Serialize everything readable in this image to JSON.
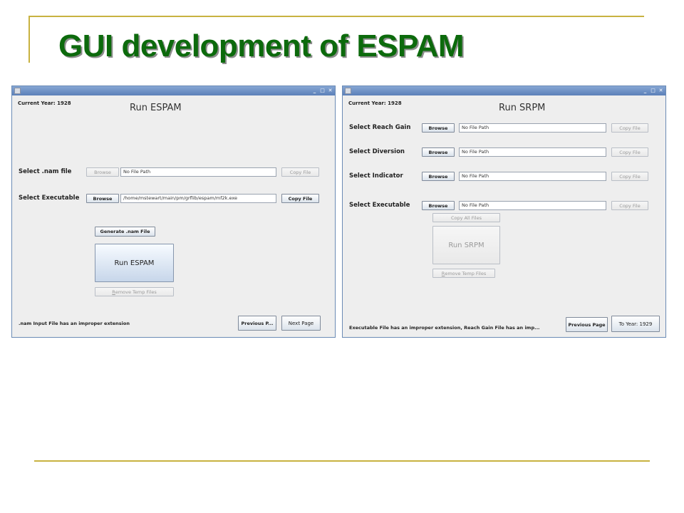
{
  "slide": {
    "title": "GUI development of ESPAM"
  },
  "window_controls": {
    "minimize": "_",
    "maximize": "□",
    "close": "✕"
  },
  "espam": {
    "current_year": "Current Year: 1928",
    "heading": "Run ESPAM",
    "nam_label": "Select .nam file",
    "nam_browse": "Browse",
    "nam_path": "No File Path",
    "nam_copy": "Copy File",
    "exe_label": "Select Executable",
    "exe_browse": "Browse",
    "exe_path": "/home/mstewart/main/pm/grflib/espam/mf2k.exe",
    "exe_copy": "Copy File",
    "generate": "Generate .nam File",
    "run": "Run ESPAM",
    "remove_temp_prefix": "R",
    "remove_temp_rest": "emove Temp Files",
    "status": ".nam Input File has an improper extension",
    "prev": "Previous P...",
    "next": "Next Page"
  },
  "srpm": {
    "current_year": "Current Year: 1928",
    "heading": "Run SRPM",
    "rows": [
      {
        "label": "Select Reach Gain",
        "browse": "Browse",
        "path": "No File Path",
        "copy": "Copy File"
      },
      {
        "label": "Select Diversion",
        "browse": "Browse",
        "path": "No File Path",
        "copy": "Copy File"
      },
      {
        "label": "Select Indicator",
        "browse": "Browse",
        "path": "No File Path",
        "copy": "Copy File"
      },
      {
        "label": "Select Executable",
        "browse": "Browse",
        "path": "No File Path",
        "copy": "Copy File"
      }
    ],
    "copy_all": "Copy All Files",
    "run": "Run SRPM",
    "remove_temp_prefix": "R",
    "remove_temp_rest": "emove Temp Files",
    "status": "Executable File has an improper extension, Reach Gain File has an imp...",
    "prev": "Previous Page",
    "next": "To Year: 1929"
  }
}
